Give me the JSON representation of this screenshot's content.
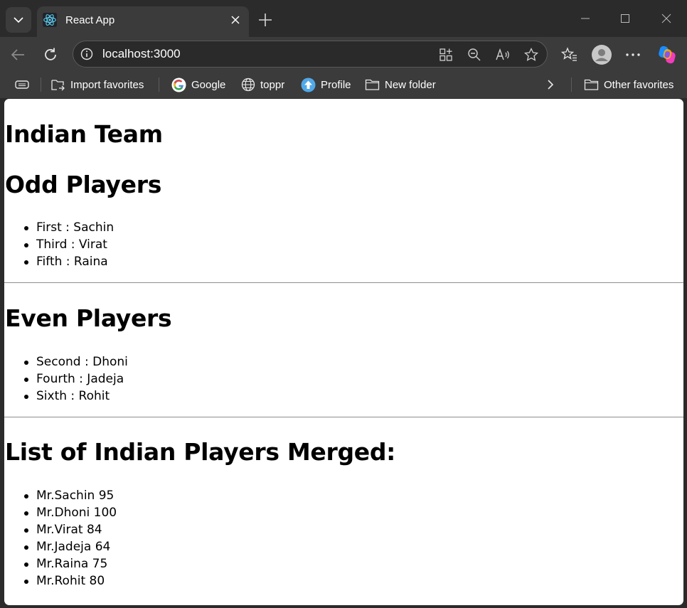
{
  "browser": {
    "tab_title": "React App",
    "url": "localhost:3000",
    "bookmarks": [
      "Import favorites",
      "Google",
      "toppr",
      "Profile",
      "New folder"
    ],
    "other_favorites": "Other favorites"
  },
  "page": {
    "title": "Indian Team",
    "odd_heading": "Odd Players",
    "odd_players": [
      "First : Sachin",
      "Third : Virat",
      "Fifth : Raina"
    ],
    "even_heading": "Even Players",
    "even_players": [
      "Second : Dhoni",
      "Fourth : Jadeja",
      "Sixth : Rohit"
    ],
    "merged_heading": "List of Indian Players Merged:",
    "merged_players": [
      "Mr.Sachin 95",
      "Mr.Dhoni 100",
      "Mr.Virat 84",
      "Mr.Jadeja 64",
      "Mr.Raina 75",
      "Mr.Rohit 80"
    ]
  }
}
